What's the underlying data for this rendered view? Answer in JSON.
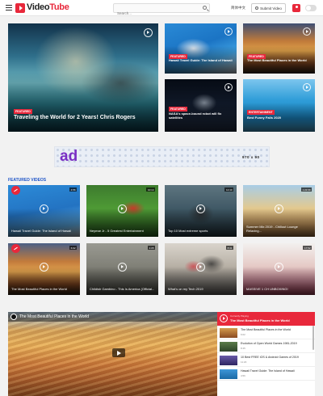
{
  "header": {
    "logo_main": "Video",
    "logo_accent": "Tube",
    "search_placeholder": "Search...",
    "language": "简体中文",
    "submit_label": "Submit Video"
  },
  "hero": {
    "main": {
      "badge": "FEATURED",
      "title": "Traveling the World for 2 Years! Chris Rogers"
    },
    "side": [
      {
        "badge": "FEATURED",
        "title": "Hawaii Travel Guide: The Island of Hawaii"
      },
      {
        "badge": "FEATURED",
        "title": "The Most Beautiful Places in the World"
      },
      {
        "badge": "FEATURED",
        "title": "NASA's space-bound robot will fix satellites"
      },
      {
        "badge": "ENTERTAINMENT",
        "title": "Best Funny Fails 2020"
      }
    ]
  },
  "ad": {
    "word": "ad",
    "size": "970 x 90"
  },
  "featured_videos": {
    "heading": "FEATURED VIDEOS",
    "items": [
      {
        "title": "Hawaii Travel Guide: The Island of Hawaii",
        "duration": "4:56"
      },
      {
        "title": "Neymar Jr - 5 Greatest Entertainment",
        "duration": "10:14"
      },
      {
        "title": "Top 10 Most extreme sports",
        "duration": "12:40"
      },
      {
        "title": "Summer Mix 2019 - Chillout Lounge Relaxing...",
        "duration": "1:22:09"
      },
      {
        "title": "The Most Beautiful Places in the World",
        "duration": "6:02"
      },
      {
        "title": "Childish Gambino - This Is America (Official...",
        "duration": "4:05"
      },
      {
        "title": "What's on my Tech 2019",
        "duration": "8:31"
      },
      {
        "title": "MASSIVE 1 CH UNBOXING!",
        "duration": "17:52"
      }
    ]
  },
  "player": {
    "title": "The Most Beautiful Places in the World",
    "playlist_label": "Currently Playing",
    "now_playing": "The Most Beautiful Places in the World",
    "items": [
      {
        "title": "The Most Beautiful Places in the World",
        "meta": "6:02"
      },
      {
        "title": "Evolution of Open World Games 1981-2019",
        "meta": "8:45"
      },
      {
        "title": "10 Best FREE iOS & Android Games of 2019",
        "meta": "11:20"
      },
      {
        "title": "Hawaii Travel Guide: The Island of Hawaii",
        "meta": "4:56"
      }
    ]
  }
}
